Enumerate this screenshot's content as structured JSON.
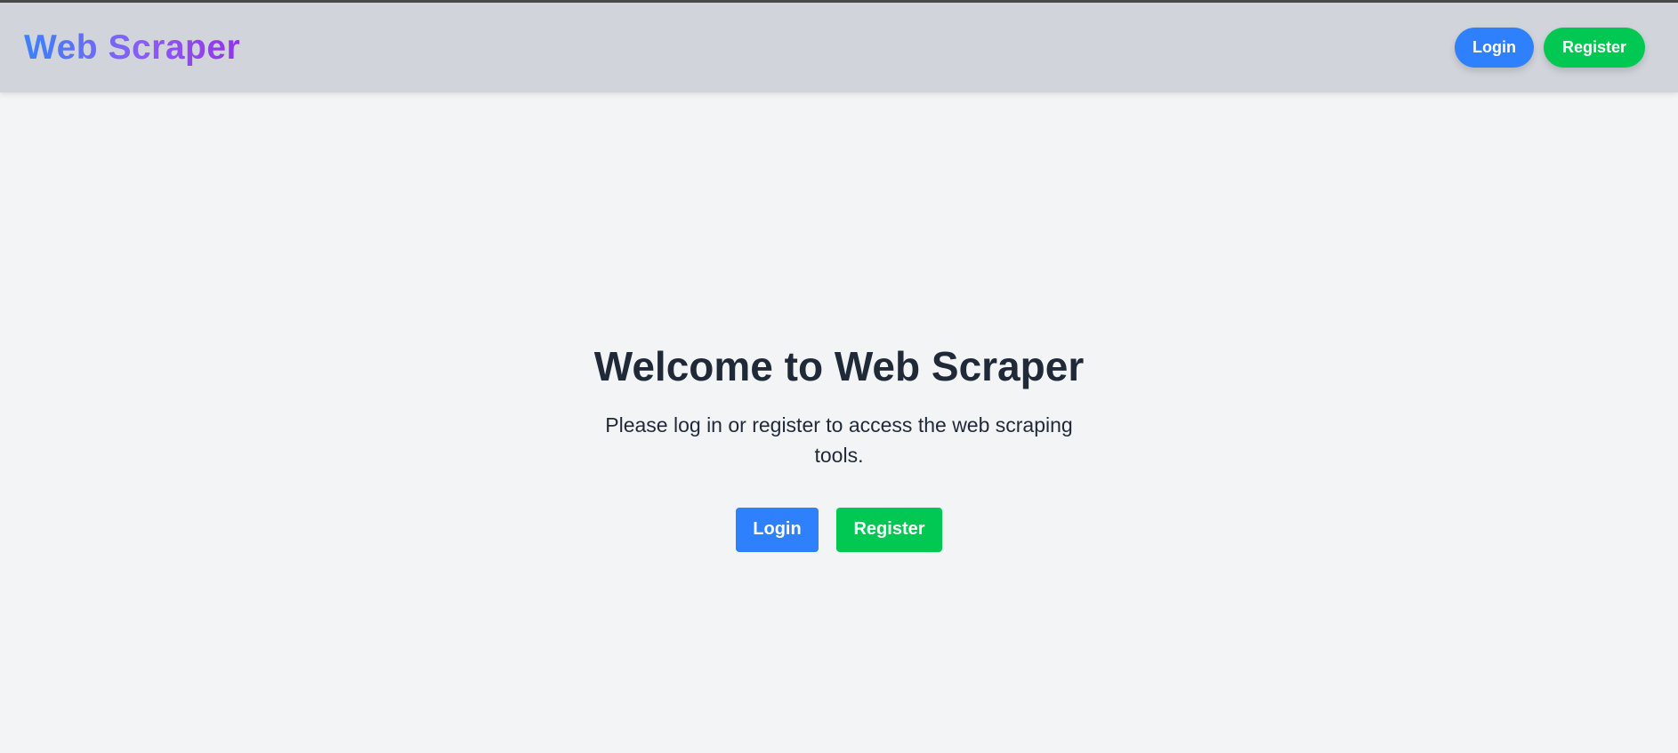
{
  "header": {
    "logo": "Web Scraper",
    "nav": {
      "login_label": "Login",
      "register_label": "Register"
    }
  },
  "main": {
    "title": "Welcome to Web Scraper",
    "subtitle": "Please log in or register to access the web scraping tools.",
    "login_label": "Login",
    "register_label": "Register"
  },
  "colors": {
    "login": "#2f80fd",
    "register": "#00c853",
    "logo_gradient_start": "#3b82f6",
    "logo_gradient_end": "#9333ea",
    "header_bg": "#d1d5db",
    "page_bg": "#f3f4f6",
    "text": "#1f2937"
  }
}
